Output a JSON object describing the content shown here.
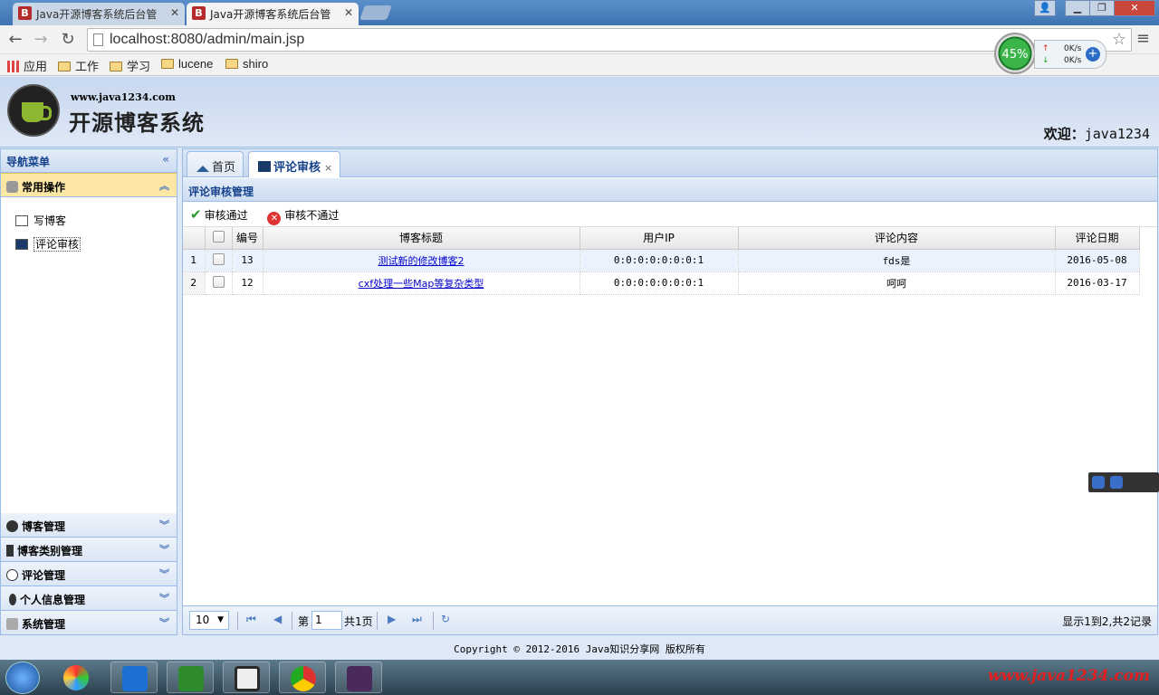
{
  "browser": {
    "tabs": [
      {
        "title": "Java开源博客系统后台管",
        "favicon": "B"
      },
      {
        "title": "Java开源博客系统后台管",
        "favicon": "B"
      }
    ],
    "url": "localhost:8080/admin/main.jsp",
    "bookmarks": {
      "apps": "应用",
      "folders": [
        "工作",
        "学习",
        "lucene",
        "shiro"
      ]
    },
    "speed_widget": {
      "percent": "45%",
      "up": "0K/s",
      "down": "0K/s"
    }
  },
  "header": {
    "site_url": "www.java1234.com",
    "site_title": "开源博客系统",
    "welcome_label": "欢迎：",
    "username": "java1234"
  },
  "west": {
    "title": "导航菜单",
    "groups": [
      {
        "label": "常用操作",
        "expanded": true,
        "items": [
          "写博客",
          "评论审核"
        ]
      },
      {
        "label": "博客管理"
      },
      {
        "label": "博客类别管理"
      },
      {
        "label": "评论管理"
      },
      {
        "label": "个人信息管理"
      },
      {
        "label": "系统管理"
      }
    ]
  },
  "center": {
    "tabs": [
      {
        "label": "首页"
      },
      {
        "label": "评论审核",
        "closable": true
      }
    ],
    "grid": {
      "title": "评论审核管理",
      "toolbar": {
        "approve": "审核通过",
        "reject": "审核不通过"
      },
      "columns": [
        "编号",
        "博客标题",
        "用户IP",
        "评论内容",
        "评论日期"
      ],
      "rows": [
        {
          "rownum": "1",
          "id": "13",
          "title": "测试新的修改博客2",
          "ip": "0:0:0:0:0:0:0:1",
          "content": "fds是",
          "date": "2016-05-08"
        },
        {
          "rownum": "2",
          "id": "12",
          "title": "cxf处理一些Map等复杂类型",
          "ip": "0:0:0:0:0:0:0:1",
          "content": "呵呵",
          "date": "2016-03-17"
        }
      ]
    },
    "pager": {
      "page_size": "10",
      "page_label": "第",
      "page": "1",
      "total_pages": "共1页",
      "info": "显示1到2,共2记录"
    }
  },
  "footer": {
    "copyright": "Copyright © 2012-2016 Java知识分享网 版权所有"
  },
  "taskbar": {
    "watermark": "www.java1234.com"
  },
  "colors": {
    "panel_border": "#99bbe8",
    "selected_group": "#fce8a4",
    "link": "#0000cc"
  }
}
